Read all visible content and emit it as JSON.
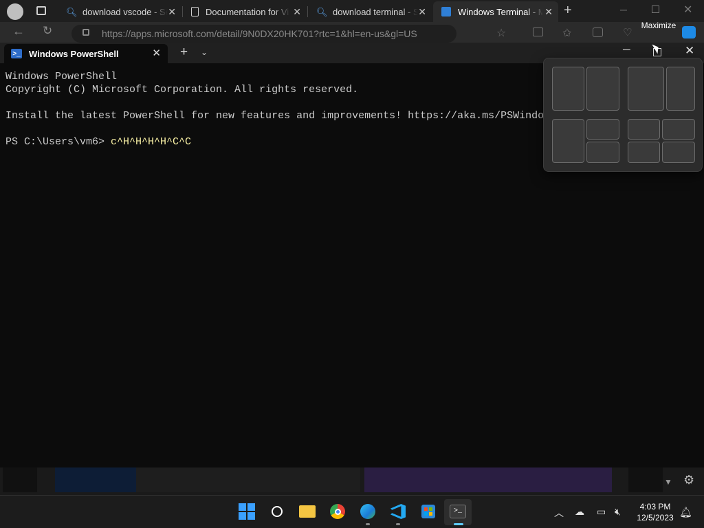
{
  "browser": {
    "tabs": [
      {
        "label": "download vscode - Se",
        "icon": "search-icon"
      },
      {
        "label": "Documentation for Vi",
        "icon": "page-icon"
      },
      {
        "label": "download terminal - S",
        "icon": "search-icon"
      },
      {
        "label": "Windows Terminal - M",
        "icon": "store-icon"
      }
    ],
    "url": "https://apps.microsoft.com/detail/9N0DX20HK701?rtc=1&hl=en-us&gl=US"
  },
  "terminal": {
    "tab_title": "Windows PowerShell",
    "lines": {
      "line1": "Windows PowerShell",
      "line2": "Copyright (C) Microsoft Corporation. All rights reserved.",
      "line3": "Install the latest PowerShell for new features and improvements! https://aka.ms/PSWindo",
      "prompt": "PS C:\\Users\\vm6> ",
      "command": "c^H^H^H^H^C^C"
    }
  },
  "tooltip": {
    "text": "Maximize"
  },
  "taskbar": {
    "apps": [
      "start-icon",
      "search-icon",
      "file-explorer-icon",
      "chrome-icon",
      "edge-icon",
      "vscode-icon",
      "store-icon",
      "terminal-icon"
    ],
    "time": "4:03 PM",
    "date": "12/5/2023"
  },
  "colors": {
    "accent": "#0078d4",
    "prompt_text": "#cccccc",
    "command_text": "#f9f1a5"
  }
}
